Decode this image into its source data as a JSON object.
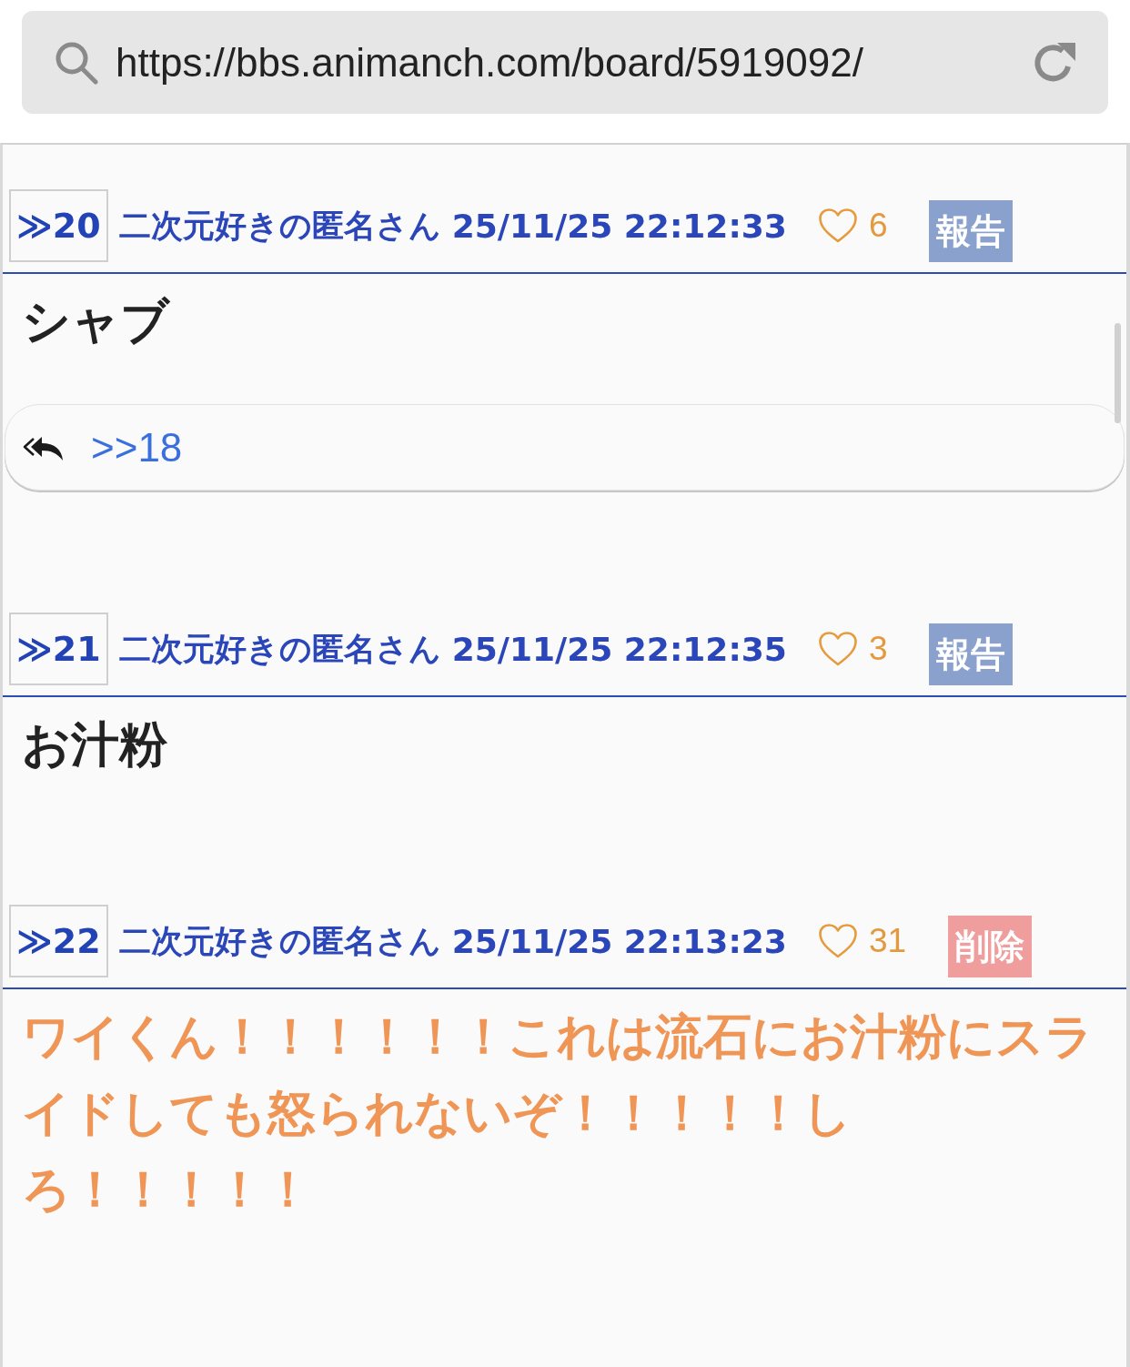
{
  "address_bar": {
    "url": "https://bbs.animanch.com/board/5919092/"
  },
  "posts": [
    {
      "number": "≫20",
      "name": "二次元好きの匿名さん",
      "date": "25/11/25 22:12:33",
      "likes": "6",
      "action": {
        "label": "報告",
        "kind": "report"
      },
      "own": false,
      "body": "シャブ",
      "reply_to": ">>18"
    },
    {
      "number": "≫21",
      "name": "二次元好きの匿名さん",
      "date": "25/11/25 22:12:35",
      "likes": "3",
      "action": {
        "label": "報告",
        "kind": "report"
      },
      "own": false,
      "body": "お汁粉"
    },
    {
      "number": "≫22",
      "name": "二次元好きの匿名さん",
      "date": "25/11/25 22:13:23",
      "likes": "31",
      "action": {
        "label": "削除",
        "kind": "delete"
      },
      "own": true,
      "body": "ワイくん！！！！！！これは流石にお汁粉にスライドしても怒られないぞ！！！！！しろ！！！！！"
    }
  ]
}
